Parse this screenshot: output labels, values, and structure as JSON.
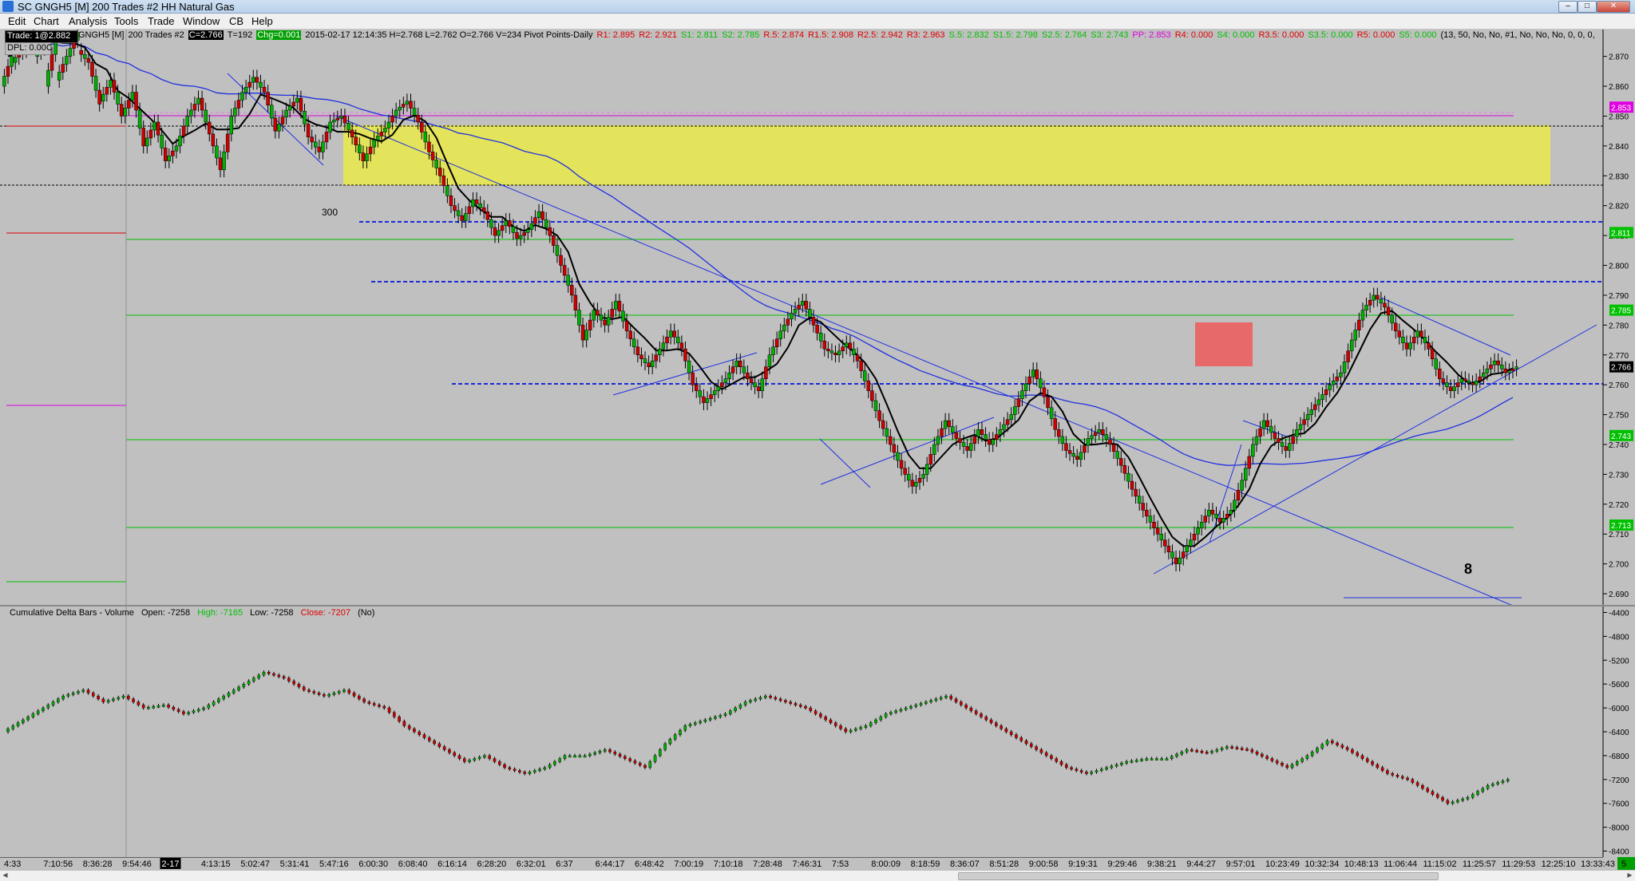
{
  "window": {
    "title": "SC GNGH5 [M]  200 Trades  #2  HH Natural Gas",
    "buttons": [
      "–",
      "□",
      "✕"
    ]
  },
  "menu": [
    "Edit",
    "Chart",
    "Analysis",
    "Tools",
    "Trade",
    "Window",
    "CB",
    "Help"
  ],
  "trade_box": {
    "line1": "Trade: 1@2.882",
    "line2": "DPL: 0.00C"
  },
  "info_bar": [
    {
      "text": "GNGH5 [M]",
      "color": "#000000"
    },
    {
      "text": "200 Trades  #2",
      "color": "#000000"
    },
    {
      "text": "C=2.766",
      "color": "#ffffff",
      "bg": "#000000"
    },
    {
      "text": "T=192",
      "color": "#000000"
    },
    {
      "text": "Chg=0.001",
      "color": "#ffffff",
      "bg": "#00a000"
    },
    {
      "text": "2015-02-17 12:14:35 H=2.768 L=2.762 O=2.766 V=234 Pivot Points-Daily",
      "color": "#000000"
    },
    {
      "text": "R1: 2.895",
      "color": "#e00000"
    },
    {
      "text": "R2: 2.921",
      "color": "#e00000"
    },
    {
      "text": "S1: 2.811",
      "color": "#00c000"
    },
    {
      "text": "S2: 2.785",
      "color": "#00c000"
    },
    {
      "text": "R.5: 2.874",
      "color": "#e00000"
    },
    {
      "text": "R1.5: 2.908",
      "color": "#e00000"
    },
    {
      "text": "R2.5: 2.942",
      "color": "#e00000"
    },
    {
      "text": "R3: 2.963",
      "color": "#e00000"
    },
    {
      "text": "S.5: 2.832",
      "color": "#00c000"
    },
    {
      "text": "S1.5: 2.798",
      "color": "#00c000"
    },
    {
      "text": "S2.5: 2.764",
      "color": "#00c000"
    },
    {
      "text": "S3: 2.743",
      "color": "#00c000"
    },
    {
      "text": "PP: 2.853",
      "color": "#e000e0"
    },
    {
      "text": "R4: 0.000",
      "color": "#e00000"
    },
    {
      "text": "S4: 0.000",
      "color": "#00c000"
    },
    {
      "text": "R3.5: 0.000",
      "color": "#e00000"
    },
    {
      "text": "S3.5: 0.000",
      "color": "#00c000"
    },
    {
      "text": "R5: 0.000",
      "color": "#e00000"
    },
    {
      "text": "S5: 0.000",
      "color": "#00c000"
    },
    {
      "text": "(13, 50, No, No, #1, No, No, No, 0, 0, 0,",
      "color": "#000000"
    }
  ],
  "price_axis": {
    "ticks": [
      "2.870",
      "2.860",
      "2.850",
      "2.840",
      "2.830",
      "2.820",
      "2.810",
      "2.800",
      "2.790",
      "2.780",
      "2.770",
      "2.760",
      "2.750",
      "2.740",
      "2.730",
      "2.720",
      "2.710",
      "2.700",
      "2.690"
    ],
    "min": 2.686,
    "max": 2.879,
    "markers": [
      {
        "text": "2.853",
        "bg": "#e000e0",
        "color": "#ffffff",
        "value": 2.853
      },
      {
        "text": "2.811",
        "bg": "#00c000",
        "color": "#ffffff",
        "value": 2.811
      },
      {
        "text": "2.785",
        "bg": "#00c000",
        "color": "#ffffff",
        "value": 2.785
      },
      {
        "text": "2.766",
        "bg": "#000000",
        "color": "#ffffff",
        "value": 2.766
      },
      {
        "text": "2.743",
        "bg": "#00c000",
        "color": "#ffffff",
        "value": 2.743
      },
      {
        "text": "2.713",
        "bg": "#00c000",
        "color": "#ffffff",
        "value": 2.713
      }
    ]
  },
  "annotations": {
    "label_300": "300",
    "label_8": "8"
  },
  "delta": {
    "header_name": "Cumulative Delta Bars - Volume",
    "open": "Open: -7258",
    "high": "High: -7165",
    "low": "Low: -7258",
    "close": "Close: -7207",
    "flag": "(No)",
    "ticks": [
      "-4400",
      "-4800",
      "-5200",
      "-5600",
      "-6000",
      "-6400",
      "-6800",
      "-7200",
      "-7600",
      "-8000",
      "-8400"
    ],
    "min": -8500,
    "max": -4300
  },
  "time_axis": [
    "4:33",
    "7:10:56",
    "8:36:28",
    "9:54:46",
    "2-17",
    "4:13:15",
    "5:02:47",
    "5:31:41",
    "5:47:16",
    "6:00:30",
    "6:08:40",
    "6:16:14",
    "6:28:20",
    "6:32:01",
    "6:37",
    "6:44:17",
    "6:48:42",
    "7:00:19",
    "7:10:18",
    "7:28:48",
    "7:46:31",
    "7:53",
    "8:00:09",
    "8:18:59",
    "8:36:07",
    "8:51:28",
    "9:00:58",
    "9:19:31",
    "9:29:46",
    "9:38:21",
    "9:44:27",
    "9:57:01",
    "10:23:49",
    "10:32:34",
    "10:48:13",
    "11:06:44",
    "11:15:02",
    "11:25:57",
    "11:29:53",
    "12:25:10",
    "13:33:43"
  ],
  "colors": {
    "background": "#c0c0c0",
    "up_candle": "#00b000",
    "down_candle": "#d00000",
    "moving_average_fast": "#000000",
    "moving_average_slow": "#2030e0",
    "highlight_zone": "#ecec50",
    "red_zone": "#ec6060"
  },
  "chart_data": {
    "type": "candlestick",
    "ohlc_path": [
      [
        2.86,
        2.87
      ],
      [
        2.868,
        2.873
      ],
      [
        2.872,
        2.878
      ],
      [
        2.87,
        2.874
      ],
      [
        2.86,
        2.876
      ],
      [
        2.862,
        2.87
      ],
      [
        2.87,
        2.878
      ],
      [
        2.872,
        2.868
      ],
      [
        2.868,
        2.854
      ],
      [
        2.855,
        2.862
      ],
      [
        2.862,
        2.85
      ],
      [
        2.85,
        2.858
      ],
      [
        2.858,
        2.84
      ],
      [
        2.84,
        2.848
      ],
      [
        2.848,
        2.835
      ],
      [
        2.835,
        2.84
      ],
      [
        2.84,
        2.85
      ],
      [
        2.85,
        2.856
      ],
      [
        2.856,
        2.844
      ],
      [
        2.844,
        2.832
      ],
      [
        2.832,
        2.85
      ],
      [
        2.85,
        2.858
      ],
      [
        2.858,
        2.863
      ],
      [
        2.863,
        2.858
      ],
      [
        2.858,
        2.845
      ],
      [
        2.845,
        2.852
      ],
      [
        2.852,
        2.856
      ],
      [
        2.856,
        2.843
      ],
      [
        2.843,
        2.838
      ],
      [
        2.838,
        2.848
      ],
      [
        2.848,
        2.85
      ],
      [
        2.85,
        2.843
      ],
      [
        2.843,
        2.835
      ],
      [
        2.835,
        2.842
      ],
      [
        2.842,
        2.846
      ],
      [
        2.846,
        2.852
      ],
      [
        2.852,
        2.855
      ],
      [
        2.855,
        2.848
      ],
      [
        2.848,
        2.838
      ],
      [
        2.838,
        2.83
      ],
      [
        2.83,
        2.82
      ],
      [
        2.82,
        2.815
      ],
      [
        2.815,
        2.822
      ],
      [
        2.822,
        2.818
      ],
      [
        2.818,
        2.81
      ],
      [
        2.81,
        2.815
      ],
      [
        2.815,
        2.809
      ],
      [
        2.809,
        2.812
      ],
      [
        2.812,
        2.818
      ],
      [
        2.818,
        2.81
      ],
      [
        2.81,
        2.8
      ],
      [
        2.8,
        2.79
      ],
      [
        2.79,
        2.775
      ],
      [
        2.775,
        2.785
      ],
      [
        2.785,
        2.78
      ],
      [
        2.78,
        2.788
      ],
      [
        2.788,
        2.778
      ],
      [
        2.778,
        2.77
      ],
      [
        2.77,
        2.766
      ],
      [
        2.766,
        2.772
      ],
      [
        2.772,
        2.778
      ],
      [
        2.778,
        2.772
      ],
      [
        2.772,
        2.76
      ],
      [
        2.76,
        2.754
      ],
      [
        2.754,
        2.758
      ],
      [
        2.758,
        2.762
      ],
      [
        2.762,
        2.768
      ],
      [
        2.768,
        2.762
      ],
      [
        2.762,
        2.758
      ],
      [
        2.758,
        2.77
      ],
      [
        2.77,
        2.778
      ],
      [
        2.778,
        2.784
      ],
      [
        2.784,
        2.788
      ],
      [
        2.788,
        2.78
      ],
      [
        2.78,
        2.772
      ],
      [
        2.772,
        2.77
      ],
      [
        2.77,
        2.774
      ],
      [
        2.774,
        2.768
      ],
      [
        2.768,
        2.758
      ],
      [
        2.758,
        2.748
      ],
      [
        2.748,
        2.74
      ],
      [
        2.74,
        2.732
      ],
      [
        2.732,
        2.726
      ],
      [
        2.726,
        2.73
      ],
      [
        2.73,
        2.74
      ],
      [
        2.74,
        2.748
      ],
      [
        2.748,
        2.742
      ],
      [
        2.742,
        2.738
      ],
      [
        2.738,
        2.745
      ],
      [
        2.745,
        2.74
      ],
      [
        2.74,
        2.745
      ],
      [
        2.745,
        2.75
      ],
      [
        2.75,
        2.758
      ],
      [
        2.758,
        2.765
      ],
      [
        2.765,
        2.756
      ],
      [
        2.756,
        2.745
      ],
      [
        2.745,
        2.738
      ],
      [
        2.738,
        2.735
      ],
      [
        2.735,
        2.742
      ],
      [
        2.742,
        2.745
      ],
      [
        2.745,
        2.74
      ],
      [
        2.74,
        2.733
      ],
      [
        2.733,
        2.725
      ],
      [
        2.725,
        2.718
      ],
      [
        2.718,
        2.712
      ],
      [
        2.712,
        2.706
      ],
      [
        2.706,
        2.7
      ],
      [
        2.7,
        2.706
      ],
      [
        2.706,
        2.712
      ],
      [
        2.712,
        2.718
      ],
      [
        2.718,
        2.714
      ],
      [
        2.714,
        2.718
      ],
      [
        2.718,
        2.728
      ],
      [
        2.728,
        2.74
      ],
      [
        2.74,
        2.748
      ],
      [
        2.748,
        2.742
      ],
      [
        2.742,
        2.738
      ],
      [
        2.738,
        2.745
      ],
      [
        2.745,
        2.75
      ],
      [
        2.75,
        2.755
      ],
      [
        2.755,
        2.76
      ],
      [
        2.76,
        2.764
      ],
      [
        2.764,
        2.775
      ],
      [
        2.775,
        2.785
      ],
      [
        2.785,
        2.79
      ],
      [
        2.79,
        2.786
      ],
      [
        2.786,
        2.778
      ],
      [
        2.778,
        2.772
      ],
      [
        2.772,
        2.778
      ],
      [
        2.778,
        2.772
      ],
      [
        2.772,
        2.762
      ],
      [
        2.762,
        2.758
      ],
      [
        2.758,
        2.762
      ],
      [
        2.762,
        2.76
      ],
      [
        2.76,
        2.764
      ],
      [
        2.764,
        2.768
      ],
      [
        2.768,
        2.764
      ],
      [
        2.764,
        2.766
      ]
    ],
    "delta_path": [
      -6400,
      -6200,
      -6000,
      -5800,
      -5700,
      -5900,
      -5800,
      -6000,
      -5950,
      -6100,
      -6000,
      -5800,
      -5600,
      -5400,
      -5500,
      -5700,
      -5800,
      -5700,
      -5900,
      -6000,
      -6300,
      -6500,
      -6700,
      -6900,
      -6800,
      -7000,
      -7100,
      -7000,
      -6800,
      -6800,
      -6700,
      -6850,
      -7000,
      -6600,
      -6300,
      -6200,
      -6100,
      -5900,
      -5800,
      -5900,
      -6000,
      -6200,
      -6400,
      -6300,
      -6100,
      -6000,
      -5900,
      -5800,
      -6000,
      -6200,
      -6400,
      -6600,
      -6800,
      -7000,
      -7100,
      -7000,
      -6900,
      -6850,
      -6850,
      -6700,
      -6750,
      -6650,
      -6700,
      -6850,
      -7000,
      -6800,
      -6550,
      -6700,
      -6900,
      -7100,
      -7200,
      -7400,
      -7600,
      -7500,
      -7300,
      -7200
    ]
  }
}
